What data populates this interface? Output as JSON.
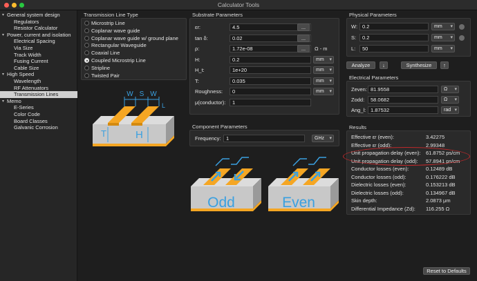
{
  "window": {
    "title": "Calculator Tools"
  },
  "sidebar": {
    "items": [
      {
        "label": "General system design",
        "group": true,
        "expanded": true
      },
      {
        "label": "Regulators"
      },
      {
        "label": "Resistor Calculator"
      },
      {
        "label": "Power, current and isolation",
        "group": true,
        "expanded": true
      },
      {
        "label": "Electrical Spacing"
      },
      {
        "label": "Via Size"
      },
      {
        "label": "Track Width"
      },
      {
        "label": "Fusing Current"
      },
      {
        "label": "Cable Size"
      },
      {
        "label": "High Speed",
        "group": true,
        "expanded": true
      },
      {
        "label": "Wavelength"
      },
      {
        "label": "RF Attenuators"
      },
      {
        "label": "Transmission Lines",
        "selected": true
      },
      {
        "label": "Memo",
        "group": true,
        "expanded": true
      },
      {
        "label": "E-Series"
      },
      {
        "label": "Color Code"
      },
      {
        "label": "Board Classes"
      },
      {
        "label": "Galvanic Corrosion"
      }
    ]
  },
  "tline": {
    "title": "Transmission Line Type",
    "options": [
      "Microstrip Line",
      "Coplanar wave guide",
      "Coplanar wave guide w/ ground plane",
      "Rectangular Waveguide",
      "Coaxial Line",
      "Coupled Microstrip Line",
      "Stripline",
      "Twisted Pair"
    ],
    "selected": 5
  },
  "diagram": {
    "w": "W",
    "s": "S",
    "w2": "W",
    "l": "L",
    "t": "T",
    "h": "H"
  },
  "substrate": {
    "title": "Substrate Parameters",
    "rows": [
      {
        "label": "εr:",
        "value": "4.5",
        "btn": "..."
      },
      {
        "label": "tan δ:",
        "value": "0.02",
        "btn": "..."
      },
      {
        "label": "ρ:",
        "value": "1.72e-08",
        "btn": "...",
        "unit": "Ω - m"
      },
      {
        "label": "H:",
        "value": "0.2",
        "select": "mm"
      },
      {
        "label": "H_t:",
        "value": "1e+20",
        "select": "mm"
      },
      {
        "label": "T:",
        "value": "0.035",
        "select": "mm"
      },
      {
        "label": "Roughness:",
        "value": "0",
        "select": "mm"
      },
      {
        "label": "μ(conductor):",
        "value": "1"
      }
    ]
  },
  "component": {
    "title": "Component Parameters",
    "freq_label": "Frequency:",
    "freq_value": "1",
    "freq_unit": "GHz"
  },
  "modes": {
    "odd": "Odd",
    "even": "Even"
  },
  "physical": {
    "title": "Physical Parameters",
    "rows": [
      {
        "label": "W:",
        "value": "0.2",
        "unit": "mm"
      },
      {
        "label": "S:",
        "value": "0.2",
        "unit": "mm"
      },
      {
        "label": "L:",
        "value": "50",
        "unit": "mm"
      }
    ]
  },
  "actions": {
    "analyze": "Analyze",
    "synthesize": "Synthesize",
    "down": "↓",
    "up": "↑"
  },
  "electrical": {
    "title": "Electrical Parameters",
    "rows": [
      {
        "label": "Zeven:",
        "value": "81.9558",
        "unit": "Ω"
      },
      {
        "label": "Zodd:",
        "value": "58.0682",
        "unit": "Ω"
      },
      {
        "label": "Ang_l:",
        "value": "1.87532",
        "unit": "rad"
      }
    ]
  },
  "results": {
    "title": "Results",
    "rows": [
      {
        "label": "Effective εr (even):",
        "value": "3.42275"
      },
      {
        "label": "Effective εr (odd):",
        "value": "2.99348"
      },
      {
        "label": "Unit propagation delay (even):",
        "value": "61.8752 ps/cm"
      },
      {
        "label": "Unit propagation delay (odd):",
        "value": "57.8941 ps/cm"
      },
      {
        "label": "Conductor losses (even):",
        "value": "0.12489 dB"
      },
      {
        "label": "Conductor losses (odd):",
        "value": "0.176222 dB"
      },
      {
        "label": "Dielectric losses (even):",
        "value": "0.153213 dB"
      },
      {
        "label": "Dielectric losses (odd):",
        "value": "0.134967 dB"
      },
      {
        "label": "Skin depth:",
        "value": "2.0873 μm"
      },
      {
        "label": "Differential Impedance (Zd):",
        "value": "116.255 Ω"
      }
    ]
  },
  "reset": "Reset to Defaults",
  "colors": {
    "accent": "#c0292b",
    "copper": "#f5a623",
    "arrow": "#3aa0e0"
  }
}
